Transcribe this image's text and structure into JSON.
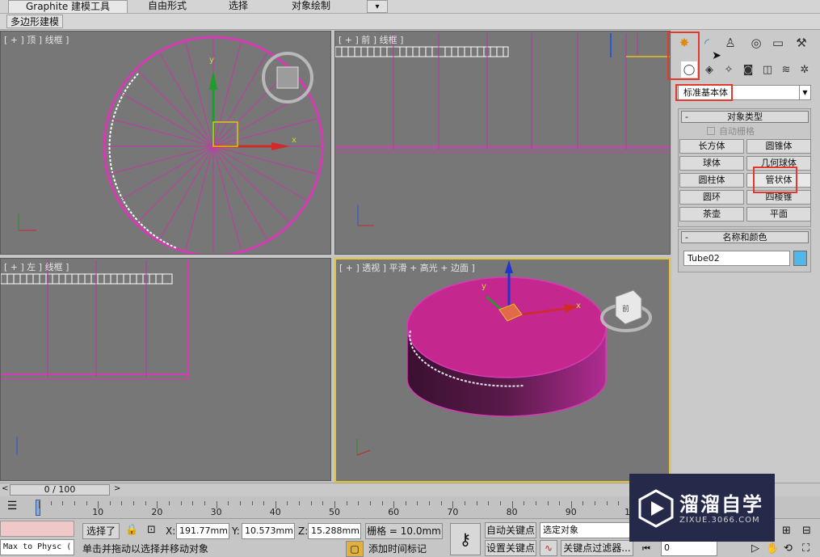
{
  "ribbon": {
    "tabs": [
      "Graphite 建模工具",
      "自由形式",
      "选择",
      "对象绘制"
    ],
    "active_tab": "Graphite 建模工具",
    "extra": "▾"
  },
  "subbar": {
    "active_button": "多边形建模"
  },
  "viewports": {
    "top": "[ + ] 顶 ] 线框 ]",
    "front": "[ + ] 前 ] 线框 ]",
    "left": "[ + ] 左 ] 线框 ]",
    "perspective": "[ + ] 透视 ] 平滑 + 高光 + 边面 ]",
    "cube_face": "前"
  },
  "command_panel": {
    "tabs": [
      "create-icon",
      "modify-icon",
      "hierarchy-icon",
      "motion-icon",
      "display-icon",
      "utilities-icon"
    ],
    "category_dropdown": "标准基本体",
    "object_type": {
      "title": "对象类型",
      "minus": "-",
      "autogrid": "自动栅格",
      "buttons": [
        "长方体",
        "圆锥体",
        "球体",
        "几何球体",
        "圆柱体",
        "管状体",
        "圆环",
        "四棱锥",
        "茶壶",
        "平面"
      ]
    },
    "name_color": {
      "title": "名称和颜色",
      "minus": "-",
      "name_value": "Tube02"
    }
  },
  "timeline": {
    "slider": "0 / 100",
    "prev": "<",
    "next": ">",
    "ticks": [
      "0",
      "10",
      "20",
      "30",
      "40",
      "50",
      "60",
      "70",
      "80",
      "90",
      "100"
    ]
  },
  "status": {
    "maxscript": "Max to Physc (",
    "selected": "选择了",
    "x_label": "X:",
    "x_value": "191.77mm",
    "y_label": "Y:",
    "y_value": "10.573mm",
    "z_label": "Z:",
    "z_value": "15.288mm",
    "grid": "栅格 = 10.0mm",
    "autokey": "自动关键点",
    "selected_object": "选定对象",
    "setkey": "设置关键点",
    "key_filters": "关键点过滤器...",
    "frame": "0",
    "prompt": "单击并拖动以选择并移动对象",
    "add_time_tag": "添加时间标记"
  },
  "watermark": {
    "title": "溜溜自学",
    "subtitle": "ZIXUE.3066.COM"
  },
  "colors": {
    "viewport_bg": "#777777",
    "mesh": "#d63ab4",
    "active_border": "#e3c636",
    "highlight": "#e03a2e"
  }
}
